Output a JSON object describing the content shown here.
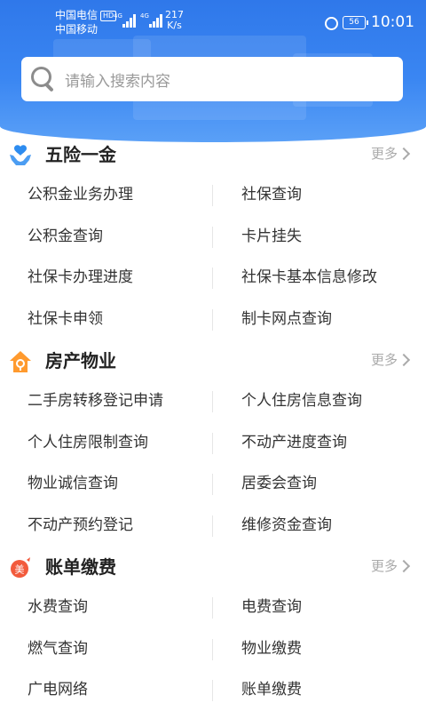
{
  "status_bar": {
    "carrier_1": "中国电信",
    "carrier_1_badge": "HD",
    "carrier_2": "中国移动",
    "network_1": "4G",
    "network_2": "4G",
    "speed_value": "217",
    "speed_unit": "K/s",
    "battery": "56",
    "time": "10:01",
    "icons": [
      "signal-bars-icon",
      "alarm-icon",
      "battery-icon"
    ]
  },
  "search": {
    "placeholder": "请输入搜索内容",
    "icon": "search-icon"
  },
  "colors": {
    "header_blue": "#3a86f2",
    "icon_blue": "#2d8cf0",
    "icon_orange": "#ff9a2e",
    "icon_red": "#f25a3c",
    "more_gray": "#aaaaaa"
  },
  "sections": [
    {
      "title": "五险一金",
      "icon": "hands-heart-icon",
      "more": "更多",
      "items": [
        [
          "公积金业务办理",
          "社保查询"
        ],
        [
          "公积金查询",
          "卡片挂失"
        ],
        [
          "社保卡办理进度",
          "社保卡基本信息修改"
        ],
        [
          "社保卡申领",
          "制卡网点查询"
        ]
      ]
    },
    {
      "title": "房产物业",
      "icon": "house-key-icon",
      "more": "更多",
      "items": [
        [
          "二手房转移登记申请",
          "个人住房信息查询"
        ],
        [
          "个人住房限制查询",
          "不动产进度查询"
        ],
        [
          "物业诚信查询",
          "居委会查询"
        ],
        [
          "不动产预约登记",
          "维修资金查询"
        ]
      ]
    },
    {
      "title": "账单缴费",
      "icon": "bill-icon",
      "icon_char": "美",
      "more": "更多",
      "items": [
        [
          "水费查询",
          "电费查询"
        ],
        [
          "燃气查询",
          "物业缴费"
        ],
        [
          "广电网络",
          "账单缴费"
        ]
      ]
    }
  ]
}
